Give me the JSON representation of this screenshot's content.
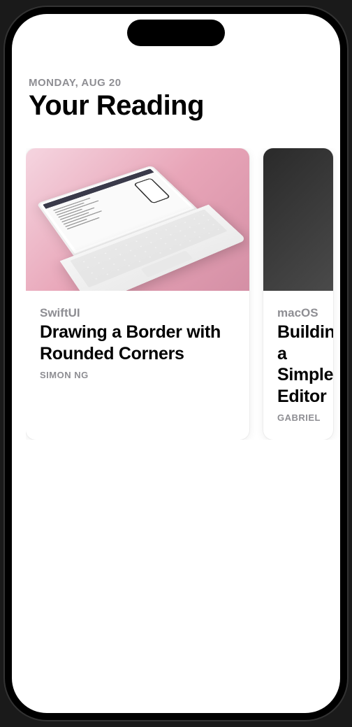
{
  "header": {
    "date": "MONDAY, AUG 20",
    "title": "Your Reading"
  },
  "cards": [
    {
      "category": "SwiftUI",
      "title": "Drawing a Border with Rounded Corners",
      "author": "SIMON NG"
    },
    {
      "category": "macOS",
      "title": "Building a Simple Editor",
      "author": "GABRIEL"
    }
  ]
}
